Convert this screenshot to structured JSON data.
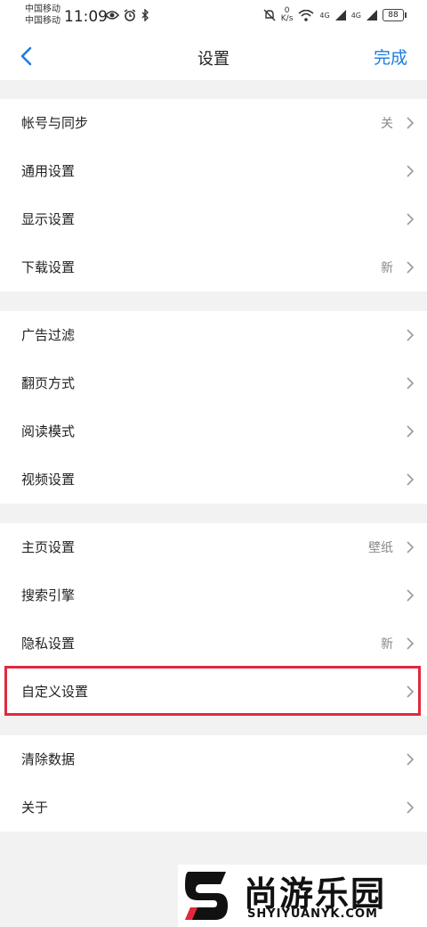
{
  "status_bar": {
    "carrier1": "中国移动",
    "carrier2": "中国移动",
    "time": "11:09",
    "net_speed_value": "0",
    "net_speed_unit": "K/s",
    "network1": "4G",
    "network2": "4G",
    "battery": "88"
  },
  "nav": {
    "title": "设置",
    "done_label": "完成"
  },
  "sections": [
    {
      "items": [
        {
          "label": "帐号与同步",
          "value": "关"
        },
        {
          "label": "通用设置",
          "value": ""
        },
        {
          "label": "显示设置",
          "value": ""
        },
        {
          "label": "下载设置",
          "value": "新"
        }
      ]
    },
    {
      "items": [
        {
          "label": "广告过滤",
          "value": ""
        },
        {
          "label": "翻页方式",
          "value": ""
        },
        {
          "label": "阅读模式",
          "value": ""
        },
        {
          "label": "视频设置",
          "value": ""
        }
      ]
    },
    {
      "items": [
        {
          "label": "主页设置",
          "value": "壁纸"
        },
        {
          "label": "搜索引擎",
          "value": ""
        },
        {
          "label": "隐私设置",
          "value": "新"
        },
        {
          "label": "自定义设置",
          "value": ""
        }
      ]
    },
    {
      "items": [
        {
          "label": "清除数据",
          "value": ""
        },
        {
          "label": "关于",
          "value": ""
        }
      ]
    }
  ],
  "colors": {
    "accent": "#1a7de0",
    "highlight": "#e2293c",
    "background": "#f2f2f2"
  },
  "watermark": {
    "name": "尚游乐园",
    "url": "SHYIYUANYK.COM"
  }
}
